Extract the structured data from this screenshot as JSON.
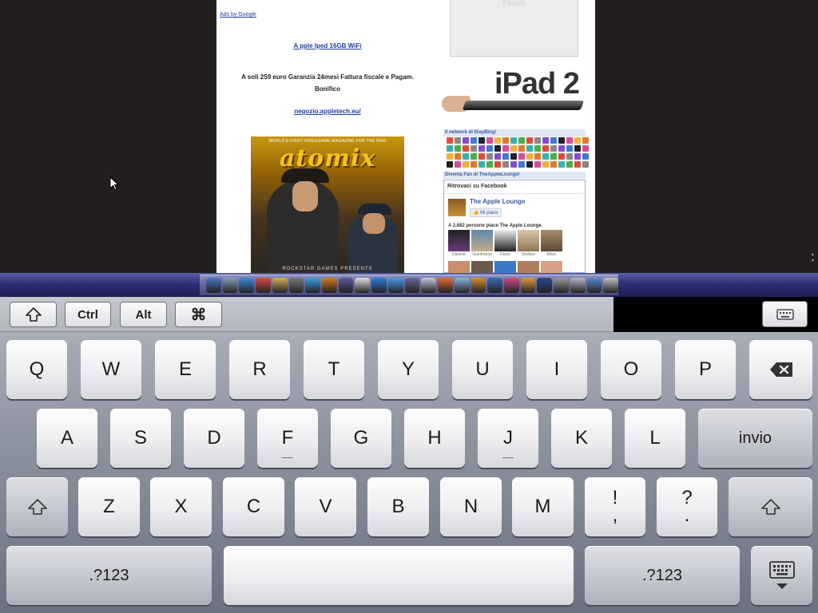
{
  "remote_page": {
    "ads_label": "Ads by Google",
    "ad_title": "A pple Iped 16GB WiFi",
    "ad_body": "A soli 259 euro Garanzia 24mesi Fattura fiscale e Pagam. Bonifico",
    "ad_link": "negozio.appletech.eu/",
    "magazine": {
      "tagline": "WORLD'S FIRST VIDEOGAME MAGAZINE FOR THE IPAD",
      "logo": "atomix",
      "footer": "ROCKSTAR GAMES PRESENTS"
    },
    "flash_label": "Flash",
    "ipad_promo_title": "iPad 2",
    "network_heading": "Il network di ISayBlog!",
    "fan_heading": "Diventa Fan di TheAppleLounge!",
    "facebook": {
      "header": "Ritrovaci su Facebook",
      "page_name": "The Apple Lounge",
      "like_button": "Mi piace",
      "count_text": "A 2,682 persone piace The Apple Lounge.",
      "fans": [
        "Daniele",
        "Gianfranco",
        "Flavio",
        "Stefano",
        "Kikor"
      ]
    }
  },
  "modifier_bar": {
    "shift": "⇧",
    "ctrl": "Ctrl",
    "alt": "Alt",
    "cmd": "⌘"
  },
  "keyboard": {
    "row1": [
      "Q",
      "W",
      "E",
      "R",
      "T",
      "Y",
      "U",
      "I",
      "O",
      "P"
    ],
    "row2": [
      "A",
      "S",
      "D",
      "F",
      "G",
      "H",
      "J",
      "K",
      "L"
    ],
    "return": "invio",
    "row3": [
      "Z",
      "X",
      "C",
      "V",
      "B",
      "N",
      "M"
    ],
    "punct1_top": "!",
    "punct1_bottom": ",",
    "punct2_top": "?",
    "punct2_bottom": ".",
    "shift": "⇧",
    "numbers_left": ".?123",
    "numbers_right": ".?123"
  },
  "colors": {
    "desktop_bg": "#231f1f",
    "link_blue": "#1b3fa5",
    "dock_band": "#2d2f78"
  }
}
